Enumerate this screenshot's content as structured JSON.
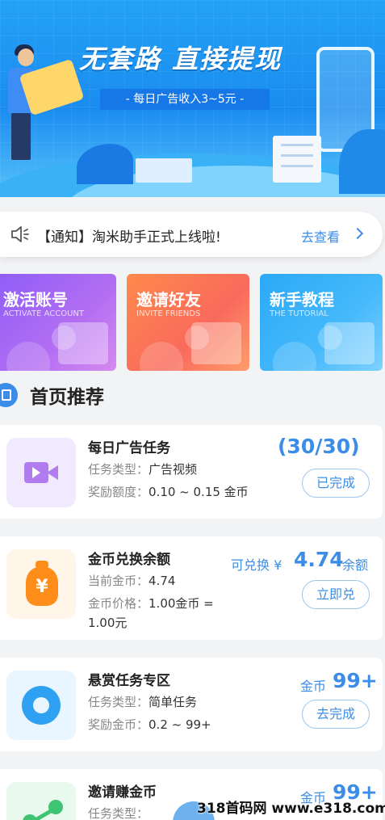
{
  "banner": {
    "title": "无套路 直接提现",
    "subtitle": "- 每日广告收入3~5元 -"
  },
  "notice": {
    "text": "【通知】淘米助手正式上线啦!",
    "more_label": "去查看",
    "icon": "speaker-icon"
  },
  "features": [
    {
      "title": "激活账号",
      "subtitle": "ACTIVATE ACCOUNT"
    },
    {
      "title": "邀请好友",
      "subtitle": "INVITE FRIENDS"
    },
    {
      "title": "新手教程",
      "subtitle": "THE TUTORIAL"
    }
  ],
  "section": {
    "title": "首页推荐",
    "icon": "clipboard-icon"
  },
  "tasks": [
    {
      "name": "每日广告任务",
      "l1_label": "任务类型：",
      "l1_value": "广告视频",
      "l2_label": "奖励额度：",
      "l2_value": "0.10 ~ 0.15 金币",
      "progress": "(30/30)",
      "button": "已完成",
      "icon": "video-camera-icon"
    },
    {
      "name": "金币兑换余额",
      "l1_label": "当前金币：",
      "l1_value": "4.74",
      "l2_label": "金币价格：",
      "l2_value": "1.00金币 =",
      "l3": "1.00元",
      "prefix": "可兑换 ¥",
      "amount": "4.74",
      "suffix": "余额",
      "button": "立即兑",
      "icon": "money-bag-icon"
    },
    {
      "name": "悬赏任务专区",
      "l1_label": "任务类型：",
      "l1_value": "简单任务",
      "l2_label": "奖励金币：",
      "l2_value": "0.2 ~ 99+",
      "prefix": "金币",
      "amount": "99+",
      "button": "去完成",
      "icon": "eye-icon"
    },
    {
      "name": "邀请赚金币",
      "l1_label": "任务类型：",
      "prefix": "金币",
      "amount": "99+",
      "icon": "share-icon"
    }
  ],
  "watermark": "318首码网 www.e318.com",
  "colors": {
    "accent": "#3b8de8",
    "banner": "#1a8cf0"
  }
}
